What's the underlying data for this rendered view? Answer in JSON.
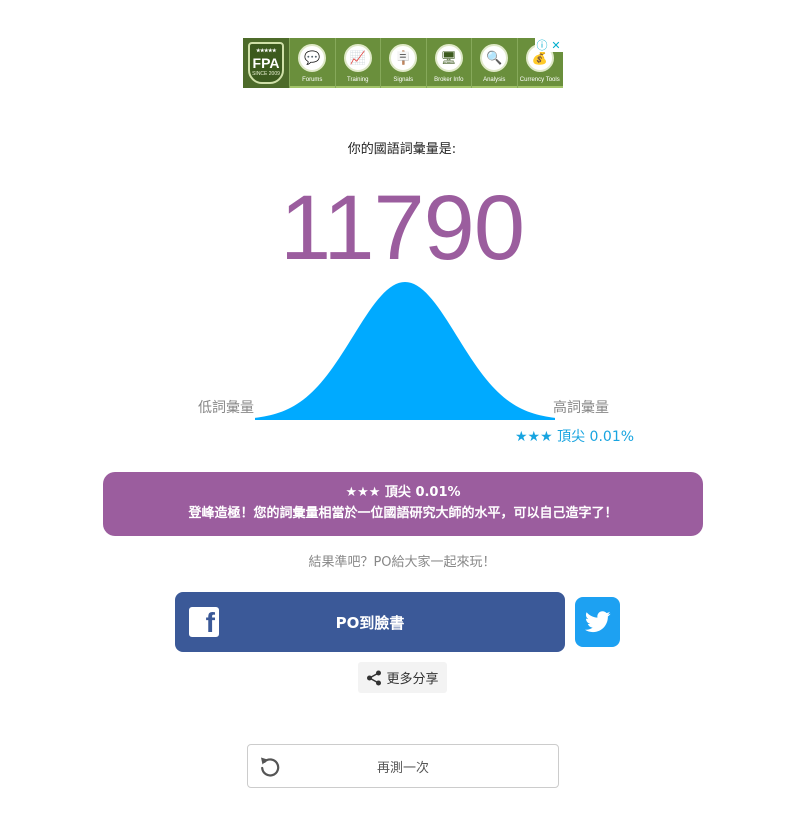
{
  "ad": {
    "logo_text": "FPA",
    "logo_stars": "★★★★★",
    "logo_sub": "SINCE 2009",
    "items": [
      {
        "label": "Forums",
        "icon": "chat-icon",
        "glyph": "💬"
      },
      {
        "label": "Training",
        "icon": "training-icon",
        "glyph": "📈"
      },
      {
        "label": "Signals",
        "icon": "signpost-icon",
        "glyph": "🪧"
      },
      {
        "label": "Broker Info",
        "icon": "monitor-icon",
        "glyph": "🖥"
      },
      {
        "label": "Analysis",
        "icon": "magnifier-icon",
        "glyph": "🔍"
      },
      {
        "label": "Currency Tools",
        "icon": "coins-icon",
        "glyph": "💰"
      }
    ],
    "info_glyph": "ⓘ",
    "close_glyph": "✕"
  },
  "result": {
    "subtitle": "你的國語詞彙量是:",
    "score": "11790",
    "low_label": "低詞彙量",
    "high_label": "高詞彙量",
    "rank": "★★★ 頂尖 0.01%",
    "box_title": "★★★ 頂尖 0.01%",
    "box_message": "登峰造極！您的詞彙量相當於一位國語研究大師的水平，可以自己造字了！"
  },
  "share": {
    "prompt": "結果準吧？PO給大家一起來玩！",
    "facebook_label": "PO到臉書",
    "more_label": "更多分享"
  },
  "retry_label": "再測一次",
  "colors": {
    "score_purple": "#9b5d9e",
    "curve_blue": "#00aaff",
    "facebook_blue": "#3b5998",
    "twitter_blue": "#1da1f2",
    "rank_blue": "#18a4e0"
  }
}
